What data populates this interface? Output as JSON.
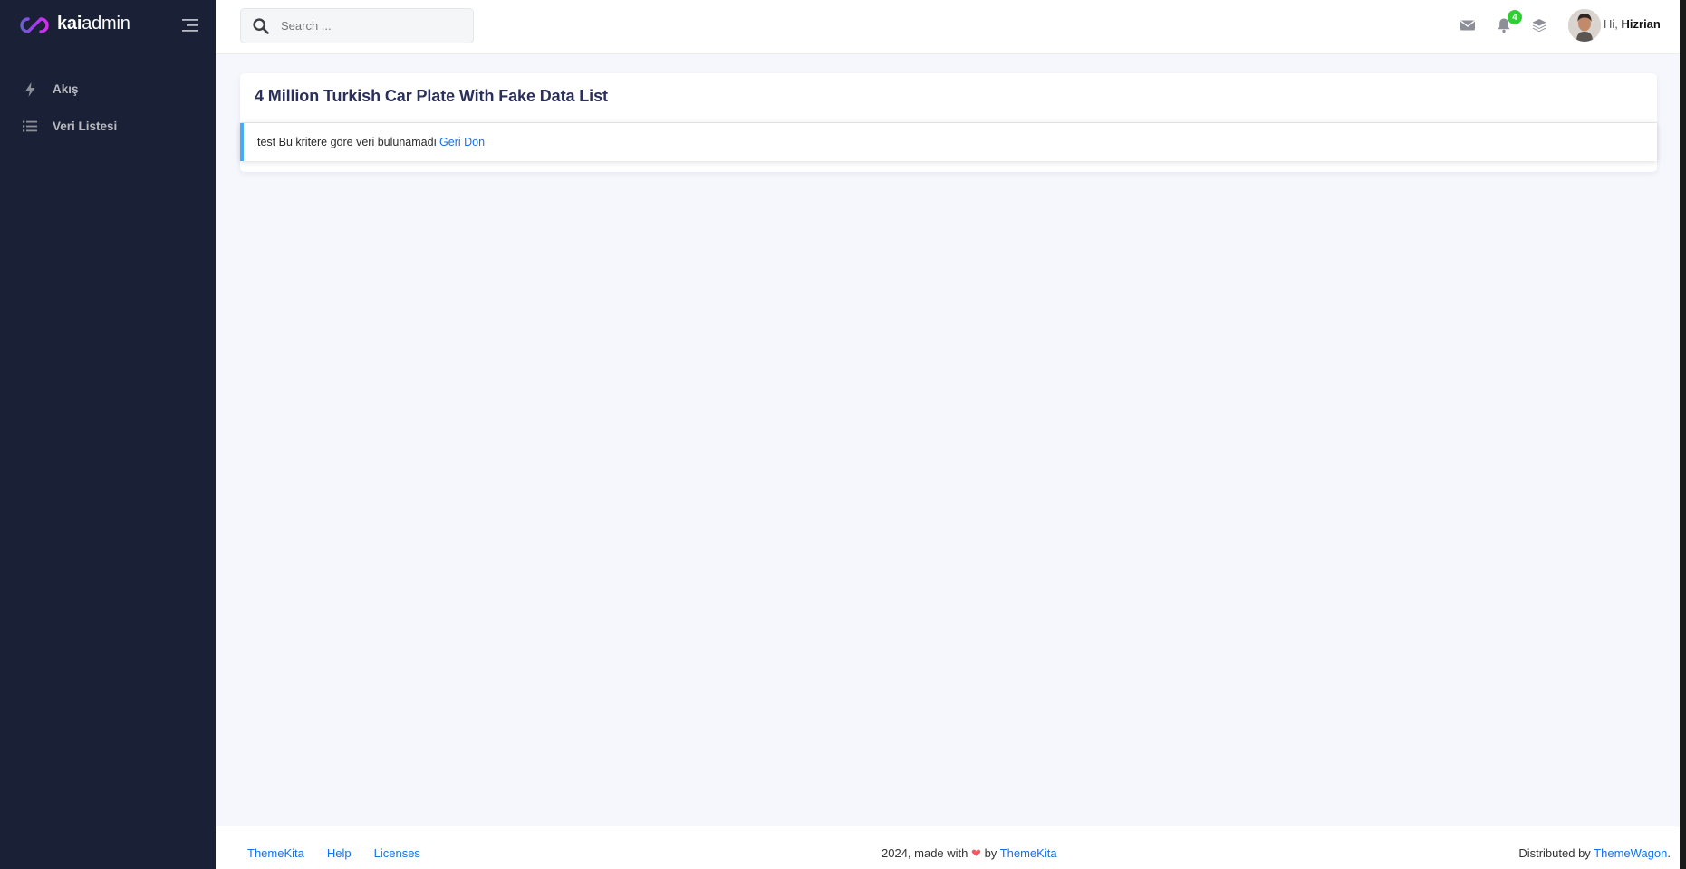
{
  "brand": {
    "name_bold": "kai",
    "name_light": "admin",
    "accent_colors": [
      "#6861ce",
      "#a43bf0",
      "#d72cf0"
    ]
  },
  "sidebar": {
    "background": "#1a2035",
    "items": [
      {
        "label": "Akış",
        "icon": "bolt-icon"
      },
      {
        "label": "Veri Listesi",
        "icon": "list-icon"
      }
    ]
  },
  "header": {
    "search": {
      "placeholder": "Search ..."
    },
    "notification_count": "4",
    "greeting": "Hi,",
    "user_name": "Hizrian"
  },
  "main": {
    "title": "4 Million Turkish Car Plate With Fake Data List",
    "alert": {
      "message": "test Bu kritere göre veri bulunamadı",
      "link_label": "Geri Dön",
      "accent": "#48abf7"
    }
  },
  "footer": {
    "links": [
      "ThemeKita",
      "Help",
      "Licenses"
    ],
    "center_prefix": "2024, made with",
    "center_by": "by",
    "center_link": "ThemeKita",
    "right_prefix": "Distributed by",
    "right_link": "ThemeWagon",
    "right_suffix": "."
  },
  "colors": {
    "link": "#1572e8",
    "badge": "#31ce36",
    "heart": "#f25961"
  }
}
